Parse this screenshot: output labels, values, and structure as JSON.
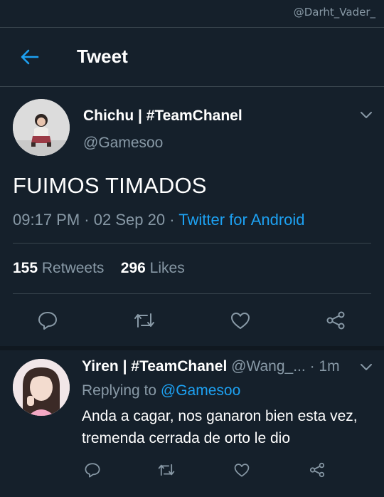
{
  "watermark": "@Darht_Vader_",
  "header": {
    "title": "Tweet"
  },
  "tweet": {
    "author_name": "Chichu | #TeamChanel",
    "author_handle": "@Gamesoo",
    "text": "FUIMOS TIMADOS",
    "time": "09:17 PM",
    "date": "02 Sep 20",
    "source": "Twitter for Android",
    "retweet_count": "155",
    "retweet_label": "Retweets",
    "like_count": "296",
    "like_label": "Likes"
  },
  "reply": {
    "author_name": "Yiren | #TeamChanel",
    "author_handle": "@Wang_...",
    "time_ago": "1m",
    "replying_label": "Replying to",
    "replying_to": "@Gamesoo",
    "text": "Anda a cagar, nos ganaron bien esta vez, tremenda cerrada de orto le dio"
  },
  "icons": {
    "back": "arrow-left-icon",
    "menu": "chevron-down-icon",
    "reply": "speech-bubble-icon",
    "retweet": "retweet-icon",
    "like": "heart-icon",
    "share": "share-icon"
  },
  "colors": {
    "background": "#15202b",
    "accent": "#1da1f2",
    "secondary_text": "#8899a6",
    "divider": "#38444d"
  }
}
